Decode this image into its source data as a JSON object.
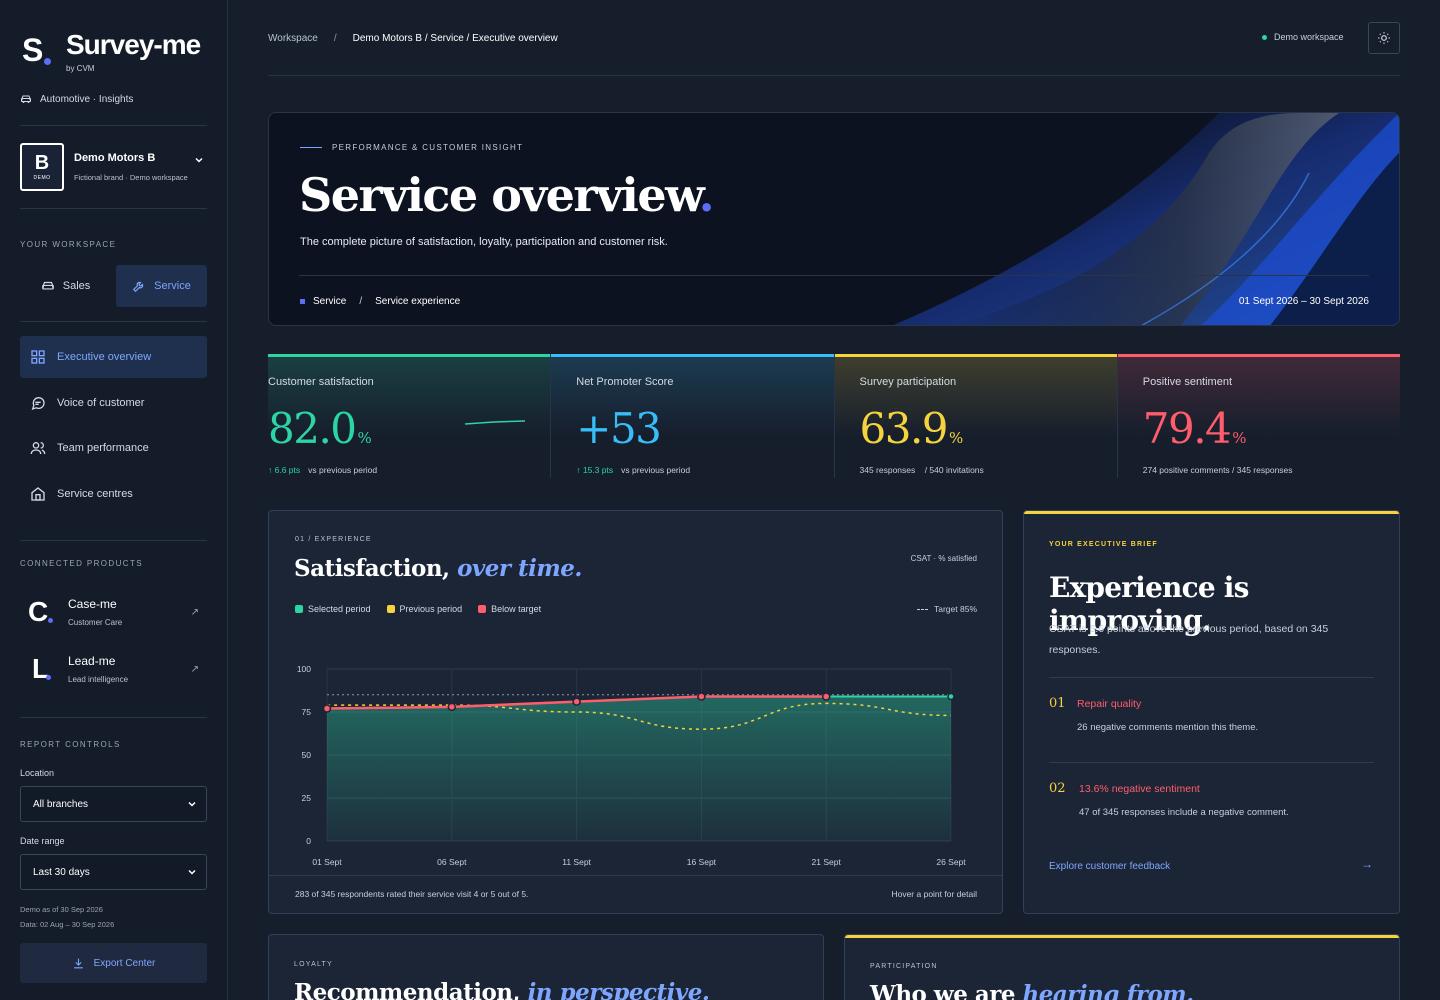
{
  "brand": {
    "initial": "S",
    "name": "Survey-me",
    "byline": "by CVM",
    "industry": "Automotive · Insights"
  },
  "account": {
    "logo_letter": "B",
    "logo_tag": "DEMO",
    "name": "Demo Motors B",
    "description": "Fictional brand · Demo workspace"
  },
  "workspace": {
    "label": "YOUR WORKSPACE",
    "options": [
      {
        "label": "Sales",
        "icon": "car-icon"
      },
      {
        "label": "Service",
        "icon": "wrench-icon"
      }
    ],
    "selected": "Service"
  },
  "nav": [
    {
      "label": "Executive overview",
      "icon": "grid-icon",
      "active": true
    },
    {
      "label": "Voice of customer",
      "icon": "chat-icon"
    },
    {
      "label": "Team performance",
      "icon": "users-icon"
    },
    {
      "label": "Service centres",
      "icon": "building-icon"
    }
  ],
  "products": {
    "label": "CONNECTED PRODUCTS",
    "items": [
      {
        "initial": "C",
        "name": "Case-me",
        "sub": "Customer Care",
        "arrow": "↗"
      },
      {
        "initial": "L",
        "name": "Lead-me",
        "sub": "Lead intelligence",
        "arrow": "↗"
      }
    ]
  },
  "controls": {
    "label": "REPORT CONTROLS",
    "location_label": "Location",
    "location_value": "All branches",
    "date_label": "Date range",
    "date_value": "Last 30 days",
    "demo_as_of": "Demo as of 30 Sep 2026",
    "data_range": "Data: 02 Aug – 30 Sep 2026",
    "export_label": "Export Center"
  },
  "breadcrumb": {
    "root": "Workspace",
    "separator": "/",
    "current": "Demo Motors B / Service / Executive overview"
  },
  "topbar": {
    "workspace_status": "Demo workspace",
    "theme_icon": "sun-icon"
  },
  "hero": {
    "kicker": "PERFORMANCE & CUSTOMER INSIGHT",
    "title": "Service overview",
    "title_dot": ".",
    "subtitle": "The complete picture of satisfaction, loyalty, participation and customer risk.",
    "crumb_a": "Service",
    "crumb_sep": "/",
    "crumb_b": "Service experience",
    "date_range": "01 Sept 2026 – 30 Sept 2026"
  },
  "kpis": [
    {
      "label": "Customer satisfaction",
      "value": "82.0",
      "unit": "%",
      "delta": "↑ 6.6 pts",
      "foot": "vs previous period",
      "color": "#2dd4a4"
    },
    {
      "label": "Net Promoter Score",
      "value": "+53",
      "unit": "",
      "delta": "↑ 15.3 pts",
      "foot": "vs previous period",
      "color": "#38bdf8"
    },
    {
      "label": "Survey participation",
      "value": "63.9",
      "unit": "%",
      "delta": "",
      "foot": "345 responses    / 540 invitations",
      "color": "#f5d33c"
    },
    {
      "label": "Positive sentiment",
      "value": "79.4",
      "unit": "%",
      "delta": "",
      "foot": "274 positive comments / 345 responses",
      "color": "#ff5d6c"
    }
  ],
  "satisfaction_card": {
    "kicker": "01 / EXPERIENCE",
    "title_plain": "Satisfaction,",
    "title_em": "over time.",
    "badge": "CSAT · % satisfied",
    "legend": [
      {
        "label": "Selected period",
        "color": "#2dd4a4"
      },
      {
        "label": "Previous period",
        "color": "#f5d33c"
      },
      {
        "label": "Below target",
        "color": "#ff5d6c"
      }
    ],
    "target_label": "Target 85%",
    "footer": "283 of 345 respondents rated their service visit 4 or 5 out of 5.",
    "hint": "Hover a point for detail"
  },
  "chart_data": {
    "type": "line",
    "x": [
      "01 Sept",
      "06 Sept",
      "11 Sept",
      "16 Sept",
      "21 Sept",
      "26 Sept"
    ],
    "series": [
      {
        "name": "Selected period",
        "values": [
          77,
          78,
          81,
          84,
          84,
          84
        ],
        "below_target_points": [
          0,
          1,
          2,
          3,
          4
        ],
        "color": "#2dd4a4",
        "below_color": "#ff5d6c"
      },
      {
        "name": "Previous period",
        "values": [
          79,
          79,
          75,
          65,
          80,
          73
        ],
        "color": "#f5d33c"
      }
    ],
    "target": 85,
    "yticks": [
      0,
      25,
      50,
      75,
      100
    ],
    "ylim": [
      0,
      100
    ],
    "grid": true
  },
  "brief": {
    "kicker": "YOUR EXECUTIVE BRIEF",
    "title": "Experience is improving.",
    "text": "CSAT is 6.6 points above the previous period, based on 345 responses.",
    "items": [
      {
        "num": "01",
        "heading": "Repair quality",
        "text": "26 negative comments mention this theme."
      },
      {
        "num": "02",
        "heading": "13.6% negative sentiment",
        "text": "47 of 345 responses include a negative comment."
      }
    ],
    "link": "Explore customer feedback",
    "link_arrow": "→"
  },
  "loyalty_card": {
    "kicker": "LOYALTY",
    "title_plain": "Recommendation,",
    "title_em": "in perspective."
  },
  "participation_card": {
    "kicker": "PARTICIPATION",
    "title_plain": "Who we are",
    "title_em": "hearing from."
  }
}
